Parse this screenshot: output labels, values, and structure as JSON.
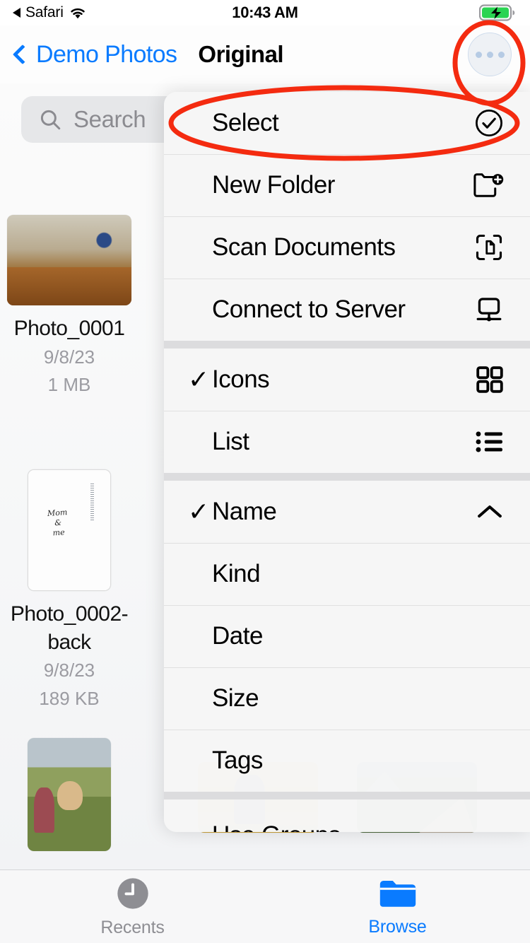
{
  "status_bar": {
    "back_app": "Safari",
    "wifi_icon": "wifi-icon",
    "time": "10:43 AM",
    "battery_icon": "battery-charging-icon"
  },
  "nav_bar": {
    "back_label": "Demo Photos",
    "title": "Original",
    "more_button_icon": "ellipsis-circle-icon"
  },
  "search": {
    "placeholder": "Search",
    "icon": "search-icon"
  },
  "files": [
    {
      "name": "Photo_0001",
      "date": "9/8/23",
      "size": "1 MB",
      "thumb": "autumn-forest-photo"
    },
    {
      "name": "Photo_0002-back",
      "date": "9/8/23",
      "size": "189 KB",
      "thumb": "handwritten-note-photo"
    },
    {
      "name": "",
      "date": "",
      "size": "",
      "thumb": "family-field-photo"
    },
    {
      "name": "",
      "date": "",
      "size": "",
      "thumb": "child-sunset-photo"
    },
    {
      "name": "",
      "date": "",
      "size": "",
      "thumb": "mountain-trail-photo"
    }
  ],
  "note_photo": {
    "handwriting": "Mom\n&\nme"
  },
  "context_menu": {
    "sections": [
      {
        "items": [
          {
            "label": "Select",
            "icon": "checkmark-circle-icon",
            "checked": false
          },
          {
            "label": "New Folder",
            "icon": "folder-plus-icon",
            "checked": false
          },
          {
            "label": "Scan Documents",
            "icon": "document-scanner-icon",
            "checked": false
          },
          {
            "label": "Connect to Server",
            "icon": "server-display-icon",
            "checked": false
          }
        ]
      },
      {
        "items": [
          {
            "label": "Icons",
            "icon": "grid-icon",
            "checked": true
          },
          {
            "label": "List",
            "icon": "list-icon",
            "checked": false
          }
        ]
      },
      {
        "items": [
          {
            "label": "Name",
            "icon": "chevron-up-icon",
            "checked": true
          },
          {
            "label": "Kind",
            "icon": "",
            "checked": false
          },
          {
            "label": "Date",
            "icon": "",
            "checked": false
          },
          {
            "label": "Size",
            "icon": "",
            "checked": false
          },
          {
            "label": "Tags",
            "icon": "",
            "checked": false
          }
        ]
      },
      {
        "items": [
          {
            "label": "Use Groups",
            "icon": "",
            "checked": false,
            "clipped": true
          }
        ]
      }
    ]
  },
  "tab_bar": {
    "tabs": [
      {
        "label": "Recents",
        "icon": "clock-icon",
        "active": false
      },
      {
        "label": "Browse",
        "icon": "folder-icon",
        "active": true
      }
    ]
  },
  "annotations": {
    "color": "#f42b10",
    "shapes": [
      "circle-around-more-button",
      "ellipse-around-select-item"
    ]
  }
}
